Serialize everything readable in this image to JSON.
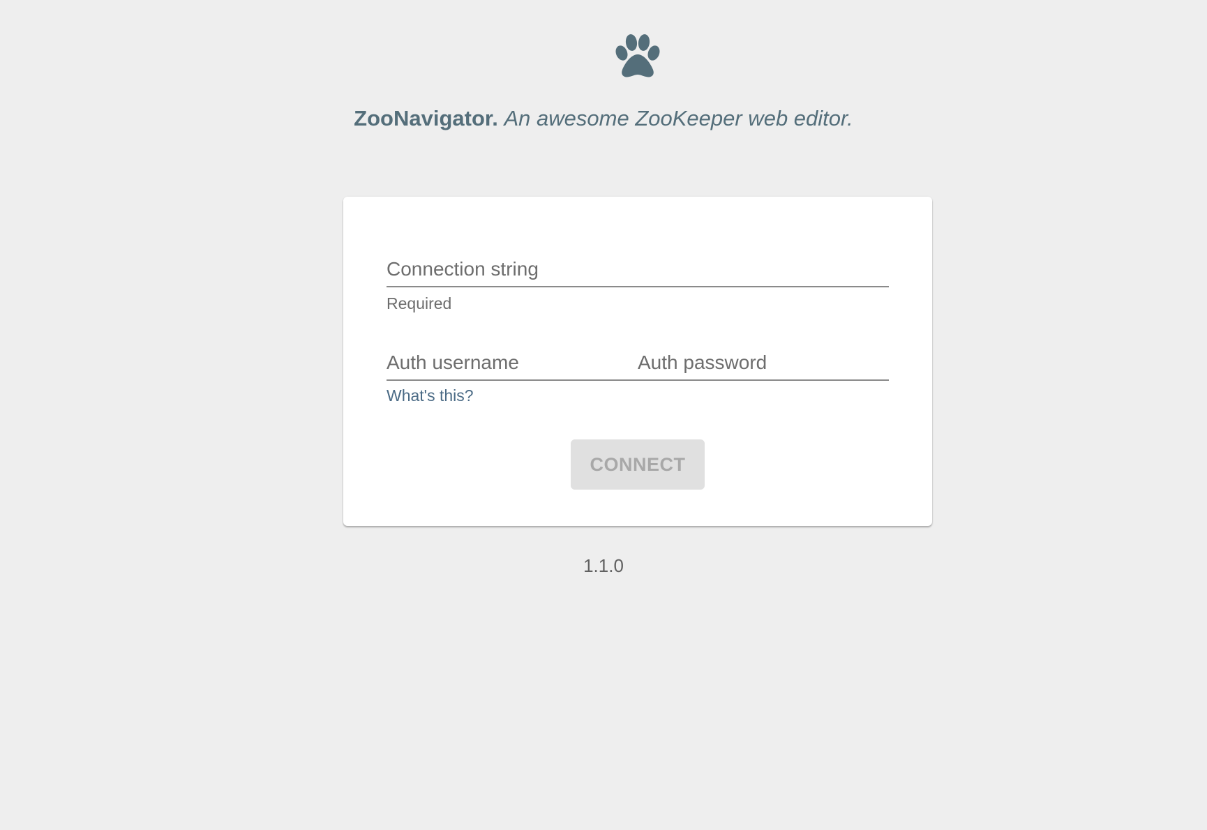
{
  "header": {
    "logo_icon": "paw-icon",
    "brand": "ZooNavigator.",
    "slogan": "An awesome ZooKeeper web editor."
  },
  "form": {
    "connection_string": {
      "placeholder": "Connection string",
      "value": "",
      "hint": "Required"
    },
    "auth_username": {
      "placeholder": "Auth username",
      "value": ""
    },
    "auth_password": {
      "placeholder": "Auth password",
      "value": ""
    },
    "help_link": "What's this?",
    "connect_label": "CONNECT",
    "connect_disabled": true
  },
  "footer": {
    "version": "1.1.0"
  },
  "colors": {
    "background": "#eeeeee",
    "brand": "#546e7a",
    "link": "#4a6a85",
    "button_disabled_bg": "#e0e0e0",
    "button_disabled_text": "#a8a8a8"
  }
}
